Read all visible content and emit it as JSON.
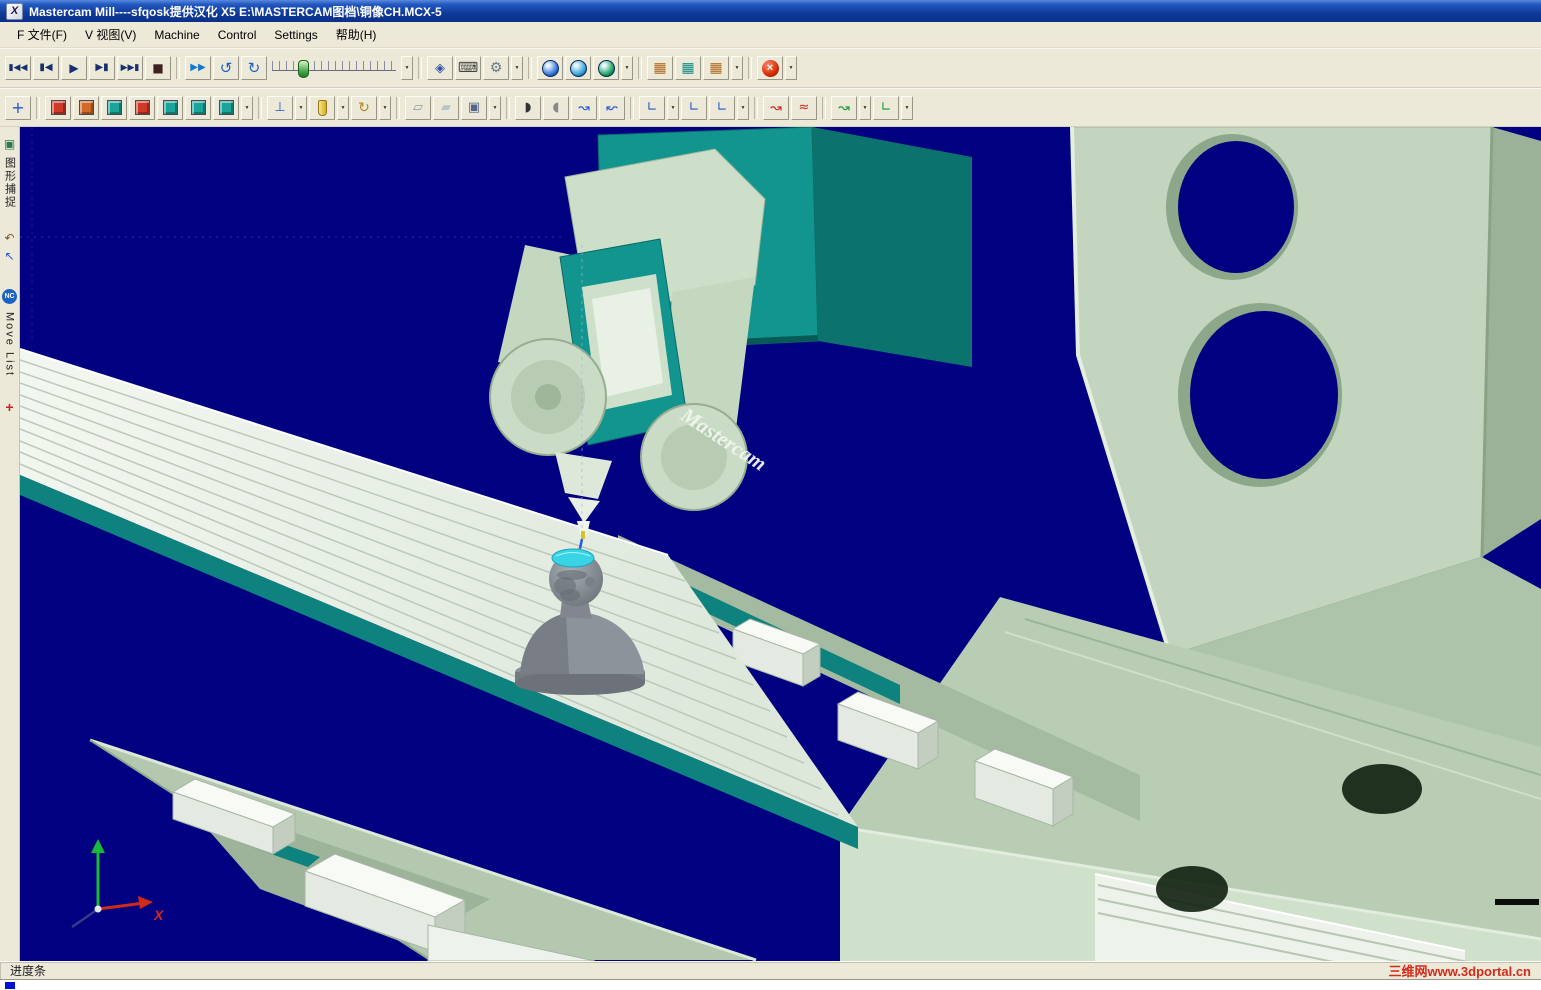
{
  "window": {
    "title": "Mastercam Mill----sfqosk提供汉化 X5   E:\\MASTERCAM图档\\铜像CH.MCX-5",
    "icon_letter": "X"
  },
  "menu": {
    "items": [
      {
        "label": "F 文件(F)"
      },
      {
        "label": "V 视图(V)"
      },
      {
        "label": "Machine"
      },
      {
        "label": "Control"
      },
      {
        "label": "Settings"
      },
      {
        "label": "帮助(H)"
      }
    ]
  },
  "ui": {
    "dropdown_glyph": "▼"
  },
  "toolbar_top": {
    "buttons": [
      {
        "name": "go-to-start-button",
        "t": "g",
        "glyph": "▮◀◀",
        "color": "#16306e",
        "fs": 9
      },
      {
        "name": "step-back-button",
        "t": "g",
        "glyph": "▮◀",
        "color": "#16306e",
        "fs": 10
      },
      {
        "name": "play-button",
        "t": "g",
        "glyph": "▶",
        "color": "#16306e",
        "fs": 12
      },
      {
        "name": "step-forward-button",
        "t": "g",
        "glyph": "▶▮",
        "color": "#16306e",
        "fs": 10
      },
      {
        "name": "go-to-end-button",
        "t": "g",
        "glyph": "▶▶▮",
        "color": "#16306e",
        "fs": 9
      },
      {
        "name": "stop-button",
        "t": "g",
        "glyph": "■",
        "color": "#402020",
        "fs": 12
      },
      {
        "sep": true
      },
      {
        "name": "fast-forward-button",
        "t": "g",
        "glyph": "▶▶",
        "color": "#1878c8",
        "fs": 10
      },
      {
        "name": "rotate-ccw-button",
        "t": "g",
        "glyph": "↺",
        "color": "#2060c0",
        "fs": 15
      },
      {
        "name": "rotate-cw-button",
        "t": "g",
        "glyph": "↻",
        "color": "#2060c0",
        "fs": 15
      },
      {
        "name": "speed-slider",
        "t": "slider",
        "dd": true
      },
      {
        "sep": true
      },
      {
        "name": "display-settings-button",
        "t": "g",
        "glyph": "◈",
        "color": "#3355aa",
        "fs": 13
      },
      {
        "name": "keyboard-button",
        "t": "g",
        "glyph": "⌨",
        "color": "#444444",
        "fs": 14
      },
      {
        "name": "options-gear-button",
        "t": "g",
        "glyph": "⚙",
        "color": "#667788",
        "fs": 14,
        "dd": true
      },
      {
        "sep": true
      },
      {
        "name": "view-isometric-globe-button",
        "t": "globe",
        "color": "#2b6fd4"
      },
      {
        "name": "view-front-globe-button",
        "t": "globe",
        "color": "#2b9fd4"
      },
      {
        "name": "view-top-globe-button",
        "t": "globe",
        "color": "#14a05a",
        "dd": true
      },
      {
        "sep": true
      },
      {
        "name": "machine-housing-toggle-button",
        "t": "g",
        "glyph": "▦",
        "color": "#b06a20",
        "fs": 14
      },
      {
        "name": "workpiece-display-toggle-button",
        "t": "g",
        "glyph": "▦",
        "color": "#128a84",
        "fs": 14
      },
      {
        "name": "fixture-display-toggle-button",
        "t": "g",
        "glyph": "▦",
        "color": "#b06a20",
        "fs": 14,
        "dd": true
      },
      {
        "sep": true
      },
      {
        "name": "close-simulation-button",
        "t": "redx",
        "glyph": "×",
        "dd": true
      }
    ]
  },
  "toolbar_second": {
    "buttons": [
      {
        "name": "fit-view-button",
        "t": "g",
        "glyph": "+",
        "color": "#2255cc",
        "fs": 16
      },
      {
        "sep": true
      },
      {
        "name": "stock-display-red-button",
        "t": "sq",
        "color": "#cf3a28"
      },
      {
        "name": "stock-compare-button",
        "t": "sq",
        "color": "#cf6a28"
      },
      {
        "name": "stock-display-teal-button",
        "t": "sq",
        "color": "#1aa49c"
      },
      {
        "name": "workpiece-red-button",
        "t": "sq",
        "color": "#cf3a28"
      },
      {
        "name": "workpiece-teal-button",
        "t": "sq",
        "color": "#1aa49c"
      },
      {
        "name": "fixture-teal-button",
        "t": "sq",
        "color": "#1aa49c"
      },
      {
        "name": "target-teal-button",
        "t": "sq",
        "color": "#1aa49c",
        "dd": true
      },
      {
        "sep": true
      },
      {
        "name": "tool-axis-button",
        "t": "g",
        "glyph": "⊥",
        "color": "#2255cc",
        "fs": 13,
        "dd": true
      },
      {
        "name": "tool-display-button",
        "t": "tool",
        "dd": true
      },
      {
        "name": "tool-rotate-button",
        "t": "g",
        "glyph": "↻",
        "color": "#b08820",
        "fs": 14,
        "dd": true
      },
      {
        "sep": true
      },
      {
        "name": "stock-section-button",
        "t": "g",
        "glyph": "▱",
        "color": "#8a9aa8",
        "fs": 13
      },
      {
        "name": "stock-solid-button",
        "t": "g",
        "glyph": "▰",
        "color": "#b8c4cc",
        "fs": 13
      },
      {
        "name": "stock-box-button",
        "t": "g",
        "glyph": "▣",
        "color": "#556688",
        "fs": 13,
        "dd": true
      },
      {
        "sep": true
      },
      {
        "name": "collision-check-button",
        "t": "g",
        "glyph": "◗",
        "color": "#333333",
        "fs": 13
      },
      {
        "name": "collision-report-button",
        "t": "g",
        "glyph": "◖",
        "color": "#888888",
        "fs": 13
      },
      {
        "name": "toolpath-trace-button",
        "t": "g",
        "glyph": "↝",
        "color": "#2255cc",
        "fs": 14
      },
      {
        "name": "toolpath-segment-button",
        "t": "g",
        "glyph": "↜",
        "color": "#2255cc",
        "fs": 14
      },
      {
        "sep": true
      },
      {
        "name": "axis-lock-1-button",
        "t": "g",
        "glyph": "∟",
        "color": "#2255cc",
        "fs": 13,
        "dd": true
      },
      {
        "name": "axis-lock-2-button",
        "t": "g",
        "glyph": "∟",
        "color": "#2255cc",
        "fs": 13
      },
      {
        "name": "axis-lock-3-button",
        "t": "g",
        "glyph": "∟",
        "color": "#2255cc",
        "fs": 13,
        "dd": true
      },
      {
        "sep": true
      },
      {
        "name": "path-display-red-button",
        "t": "g",
        "glyph": "↝",
        "color": "#cc2222",
        "fs": 14
      },
      {
        "name": "path-points-red-button",
        "t": "g",
        "glyph": "≈",
        "color": "#cc2222",
        "fs": 13
      },
      {
        "sep": true
      },
      {
        "name": "path-display-green-button",
        "t": "g",
        "glyph": "↝",
        "color": "#11992e",
        "fs": 14,
        "dd": true
      },
      {
        "name": "path-angle-green-button",
        "t": "g",
        "glyph": "∟",
        "color": "#11992e",
        "fs": 13,
        "dd": true
      }
    ]
  },
  "sidebar": {
    "capture_tab_label": "图形捕捉",
    "move_list_tab_label": "Move List",
    "nc_badge": "NC",
    "icons": {
      "image": "▣",
      "undo": "↶",
      "cursor": "↖",
      "axes": "+"
    }
  },
  "viewport": {
    "machine_logo": "Mastercam",
    "axis_x_label": "X",
    "background": "#000080",
    "machine_color": "#c3d5bf",
    "accent_teal": "#12958f"
  },
  "statusbar": {
    "progress_label": "进度条",
    "watermark": "三维网www.3dportal.cn"
  }
}
